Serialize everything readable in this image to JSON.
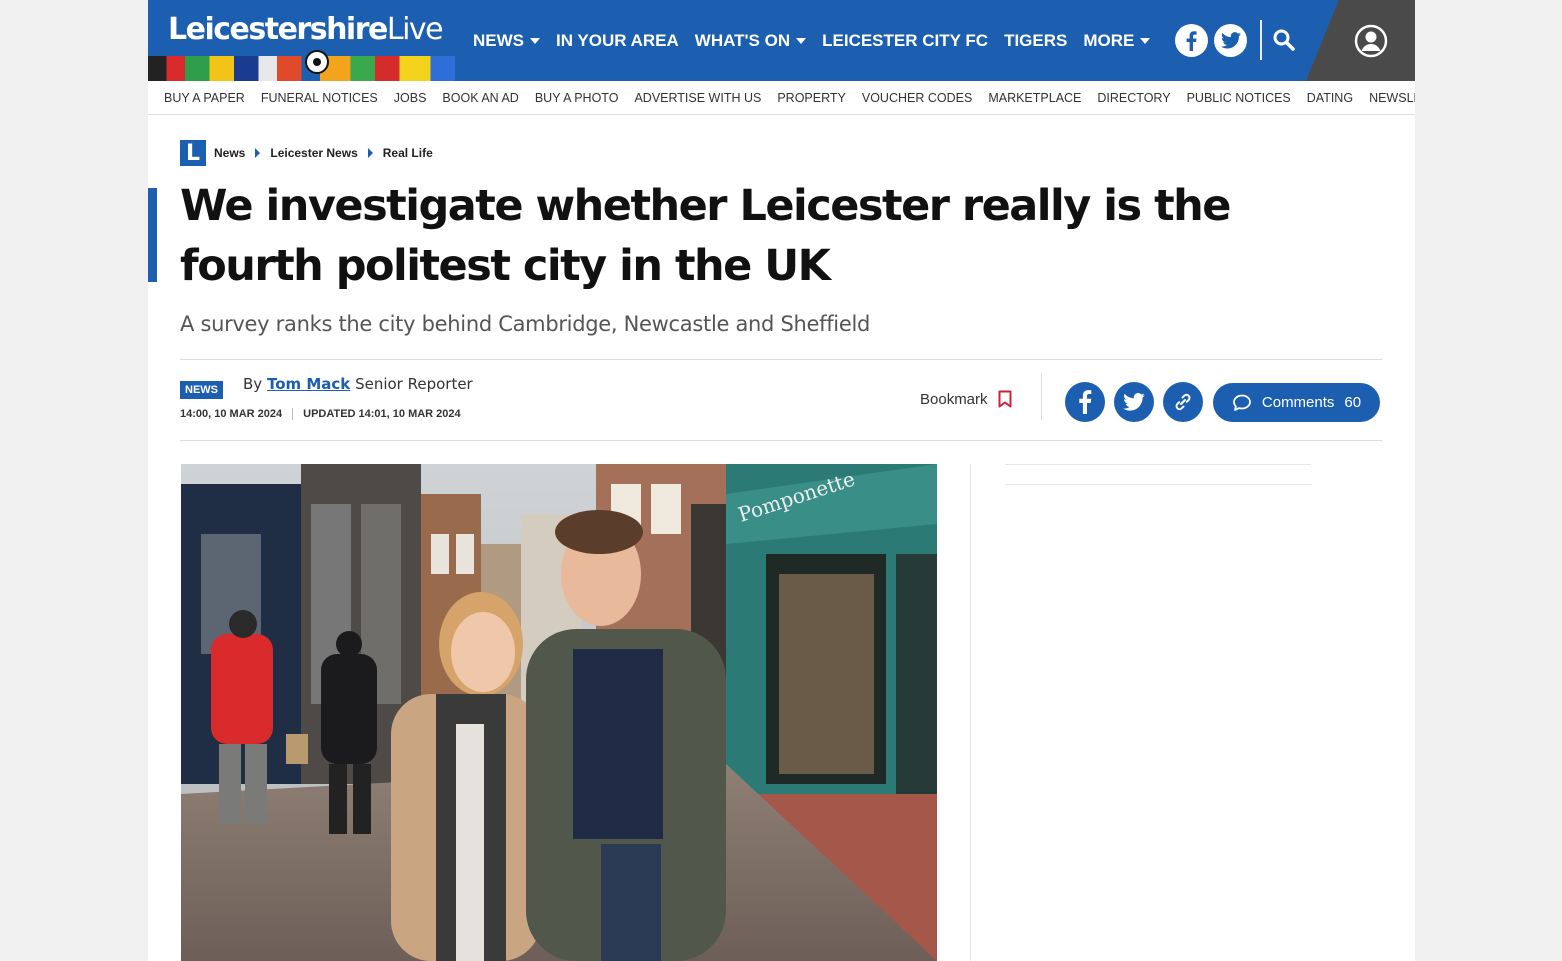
{
  "header": {
    "logo_text": "Leicestershire",
    "logo_text_live": "Live",
    "nav": [
      {
        "label": "NEWS",
        "dropdown": true
      },
      {
        "label": "IN YOUR AREA",
        "dropdown": false
      },
      {
        "label": "WHAT'S ON",
        "dropdown": true
      },
      {
        "label": "LEICESTER CITY FC",
        "dropdown": false
      },
      {
        "label": "TIGERS",
        "dropdown": false
      },
      {
        "label": "MORE",
        "dropdown": true
      }
    ],
    "icons": [
      "facebook-icon",
      "twitter-icon",
      "search-icon",
      "account-icon"
    ],
    "brand_color": "#1c5fb1"
  },
  "subnav": [
    "BUY A PAPER",
    "FUNERAL NOTICES",
    "JOBS",
    "BOOK AN AD",
    "BUY A PHOTO",
    "ADVERTISE WITH US",
    "PROPERTY",
    "VOUCHER CODES",
    "MARKETPLACE",
    "DIRECTORY",
    "PUBLIC NOTICES",
    "DATING",
    "NEWSLETTER SIGNUP"
  ],
  "breadcrumb": {
    "logo": "L",
    "items": [
      "News",
      "Leicester News",
      "Real Life"
    ]
  },
  "article": {
    "headline": "We investigate whether Leicester really is the fourth politest city in the UK",
    "subtitle": "A survey ranks the city behind Cambridge, Newcastle and Sheffield",
    "badge": "NEWS",
    "by": "By",
    "author": "Tom Mack",
    "role": "Senior Reporter",
    "published": "14:00, 10 MAR 2024",
    "updated": "UPDATED  14:01, 10 MAR 2024",
    "shop_sign": "Pomponette"
  },
  "actions": {
    "bookmark_label": "Bookmark",
    "comments_label": "Comments",
    "comments_count": "60"
  }
}
